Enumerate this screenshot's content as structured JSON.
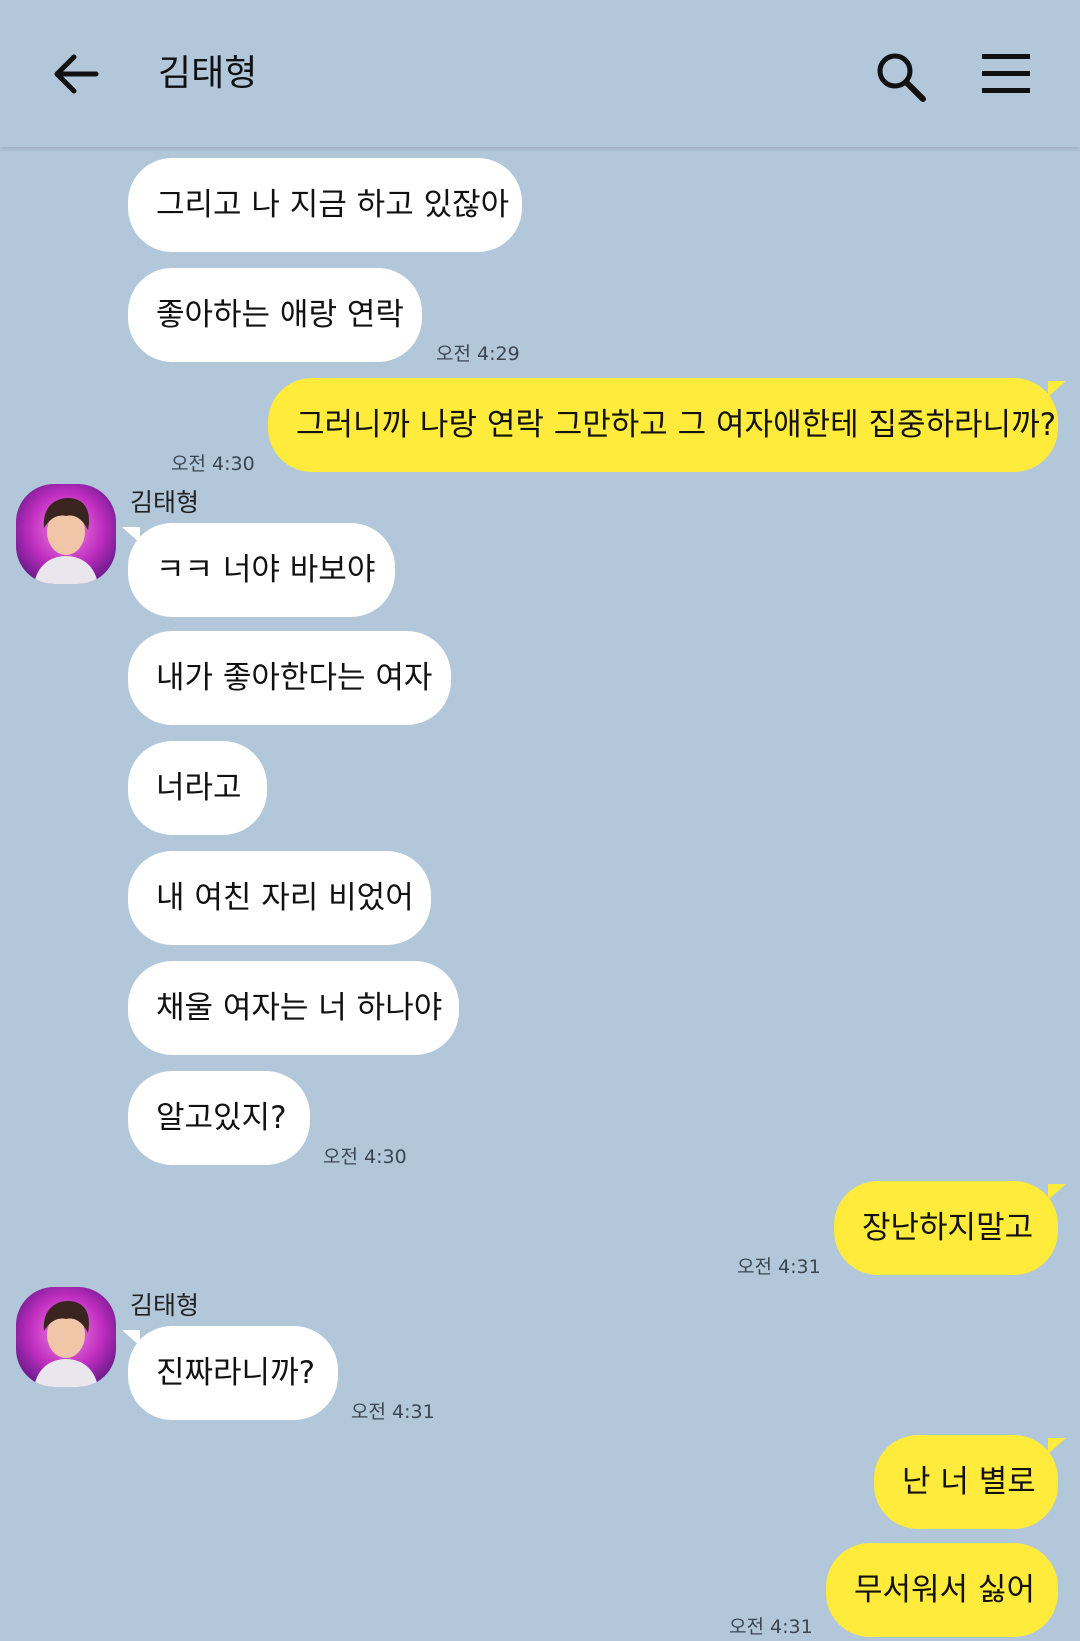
{
  "header": {
    "title": "김태형",
    "back_icon": "arrow-left-icon",
    "search_icon": "search-icon",
    "menu_icon": "hamburger-menu-icon"
  },
  "colors": {
    "background": "#b2c7da",
    "my_bubble": "#ffeb3b",
    "their_bubble": "#ffffff"
  },
  "messages": [
    {
      "text": "그리고 나 지금 하고 있잖아"
    },
    {
      "text": "좋아하는 애랑 연락",
      "time": "오전 4:29"
    },
    {
      "text": "그러니까 나랑 연락 그만하고 그 여자애한테 집중하라니까?",
      "time": "오전 4:30"
    },
    {
      "sender": "김태형",
      "text": "ㅋㅋ 너야 바보야"
    },
    {
      "text": "내가 좋아한다는 여자"
    },
    {
      "text": "너라고"
    },
    {
      "text": "내 여친 자리 비었어"
    },
    {
      "text": "채울 여자는 너 하나야"
    },
    {
      "text": "알고있지?",
      "time": "오전 4:30"
    },
    {
      "text": "장난하지말고",
      "time": "오전 4:31"
    },
    {
      "sender": "김태형",
      "text": "진짜라니까?",
      "time": "오전 4:31"
    },
    {
      "text": "난 너 별로"
    },
    {
      "text": "무서워서 싫어",
      "time": "오전 4:31"
    }
  ]
}
